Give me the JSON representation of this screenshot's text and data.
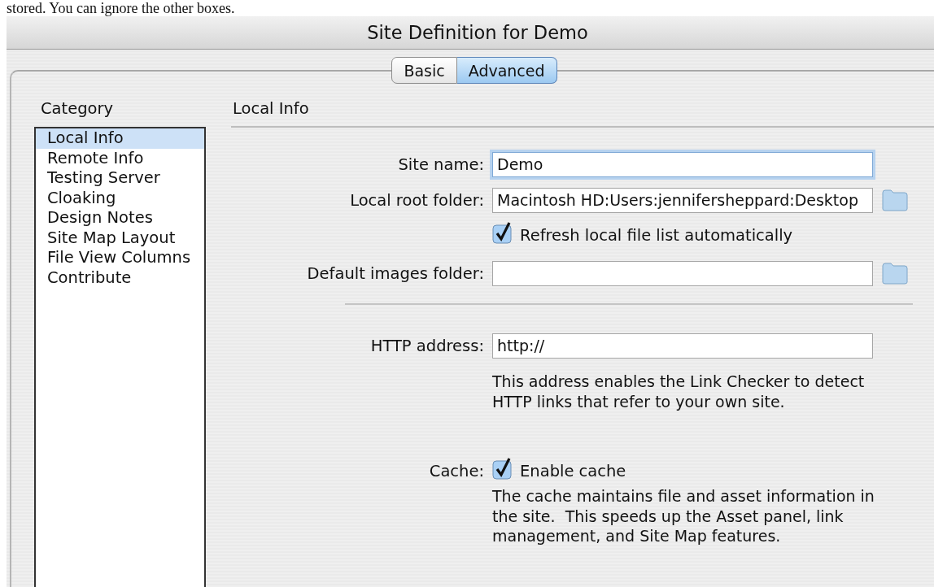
{
  "caption": "stored. You can ignore the other boxes.",
  "window": {
    "title": "Site Definition for Demo"
  },
  "tabs": [
    {
      "label": "Basic",
      "selected": false
    },
    {
      "label": "Advanced",
      "selected": true
    }
  ],
  "category": {
    "label": "Category",
    "items": [
      {
        "label": "Local Info",
        "selected": true
      },
      {
        "label": "Remote Info",
        "selected": false
      },
      {
        "label": "Testing Server",
        "selected": false
      },
      {
        "label": "Cloaking",
        "selected": false
      },
      {
        "label": "Design Notes",
        "selected": false
      },
      {
        "label": "Site Map Layout",
        "selected": false
      },
      {
        "label": "File View Columns",
        "selected": false
      },
      {
        "label": "Contribute",
        "selected": false
      }
    ]
  },
  "section": {
    "title": "Local Info"
  },
  "fields": [
    {
      "kind": "text",
      "label": "Site name:",
      "value": "Demo",
      "focused": true
    },
    {
      "kind": "folder",
      "label": "Local root folder:",
      "value": "Macintosh HD:Users:jennifersheppard:Desktop",
      "focused": false
    },
    {
      "kind": "checkbox",
      "text": "Refresh local file list automatically",
      "checked": true
    },
    {
      "kind": "folder",
      "label": "Default images folder:",
      "focused": false
    },
    {
      "kind": "divider"
    },
    {
      "kind": "text",
      "label": "HTTP address:",
      "value": "http://",
      "focused": false
    },
    {
      "kind": "note",
      "text": "This address enables the Link Checker to detect HTTP links that refer to your own site."
    },
    {
      "kind": "checkbox",
      "label": "Cache:",
      "text": "Enable cache",
      "checked": true
    },
    {
      "kind": "note",
      "text": "The cache maintains file and asset information in the site.  This speeds up the Asset panel, link management, and Site Map features."
    }
  ]
}
